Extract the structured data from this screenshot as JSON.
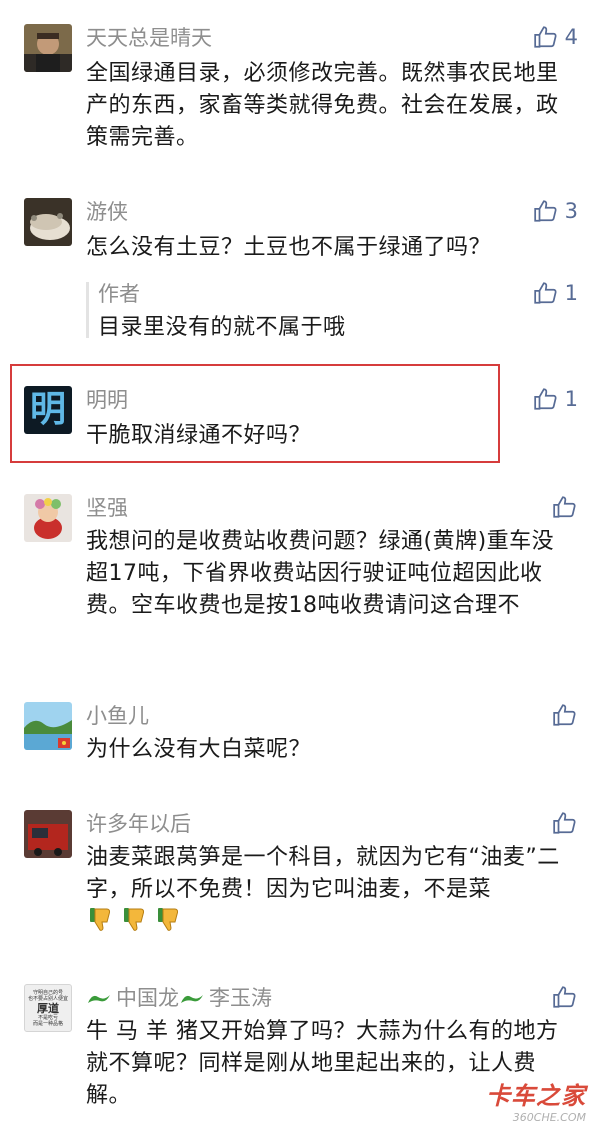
{
  "comments": [
    {
      "name": "天天总是晴天",
      "text": "全国绿通目录，必须修改完善。既然事农民地里产的东西，家畜等类就得免费。社会在发展，政策需完善。",
      "likes": "4"
    },
    {
      "name": "游侠",
      "text": "怎么没有土豆？土豆也不属于绿通了吗？",
      "likes": "3",
      "reply": {
        "name": "作者",
        "text": "目录里没有的就不属于哦",
        "likes": "1"
      }
    },
    {
      "name": "明明",
      "avatar_char": "明",
      "text": "干脆取消绿通不好吗？",
      "likes": "1"
    },
    {
      "name": "坚强",
      "text": "我想问的是收费站收费问题？绿通(黄牌)重车没超17吨，下省界收费站因行驶证吨位超因此收费。空车收费也是按18吨收费请问这合理不",
      "likes": ""
    },
    {
      "name": "小鱼儿",
      "text": "为什么没有大白菜呢？",
      "likes": ""
    },
    {
      "name": "许多年以后",
      "text": "油麦菜跟莴笋是一个科目，就因为它有“油麦”二字，所以不免费！因为它叫油麦，不是菜",
      "likes": ""
    },
    {
      "name_a": "中国龙",
      "name_b": "李玉涛",
      "avatar_lines": [
        "守明自己的号",
        "也不要占别人便宜",
        "厚道",
        "不是吃亏",
        "而是一种品格"
      ],
      "text": "牛 马 羊 猪又开始算了吗？大蒜为什么有的地方就不算呢？同样是刚从地里起出来的，让人费解。",
      "likes": ""
    }
  ],
  "watermark": {
    "main": "卡车之家",
    "sub": "360CHE.COM"
  },
  "colors": {
    "highlight": "#d63c3c",
    "like": "#576b95",
    "name": "#8e8e8e"
  }
}
